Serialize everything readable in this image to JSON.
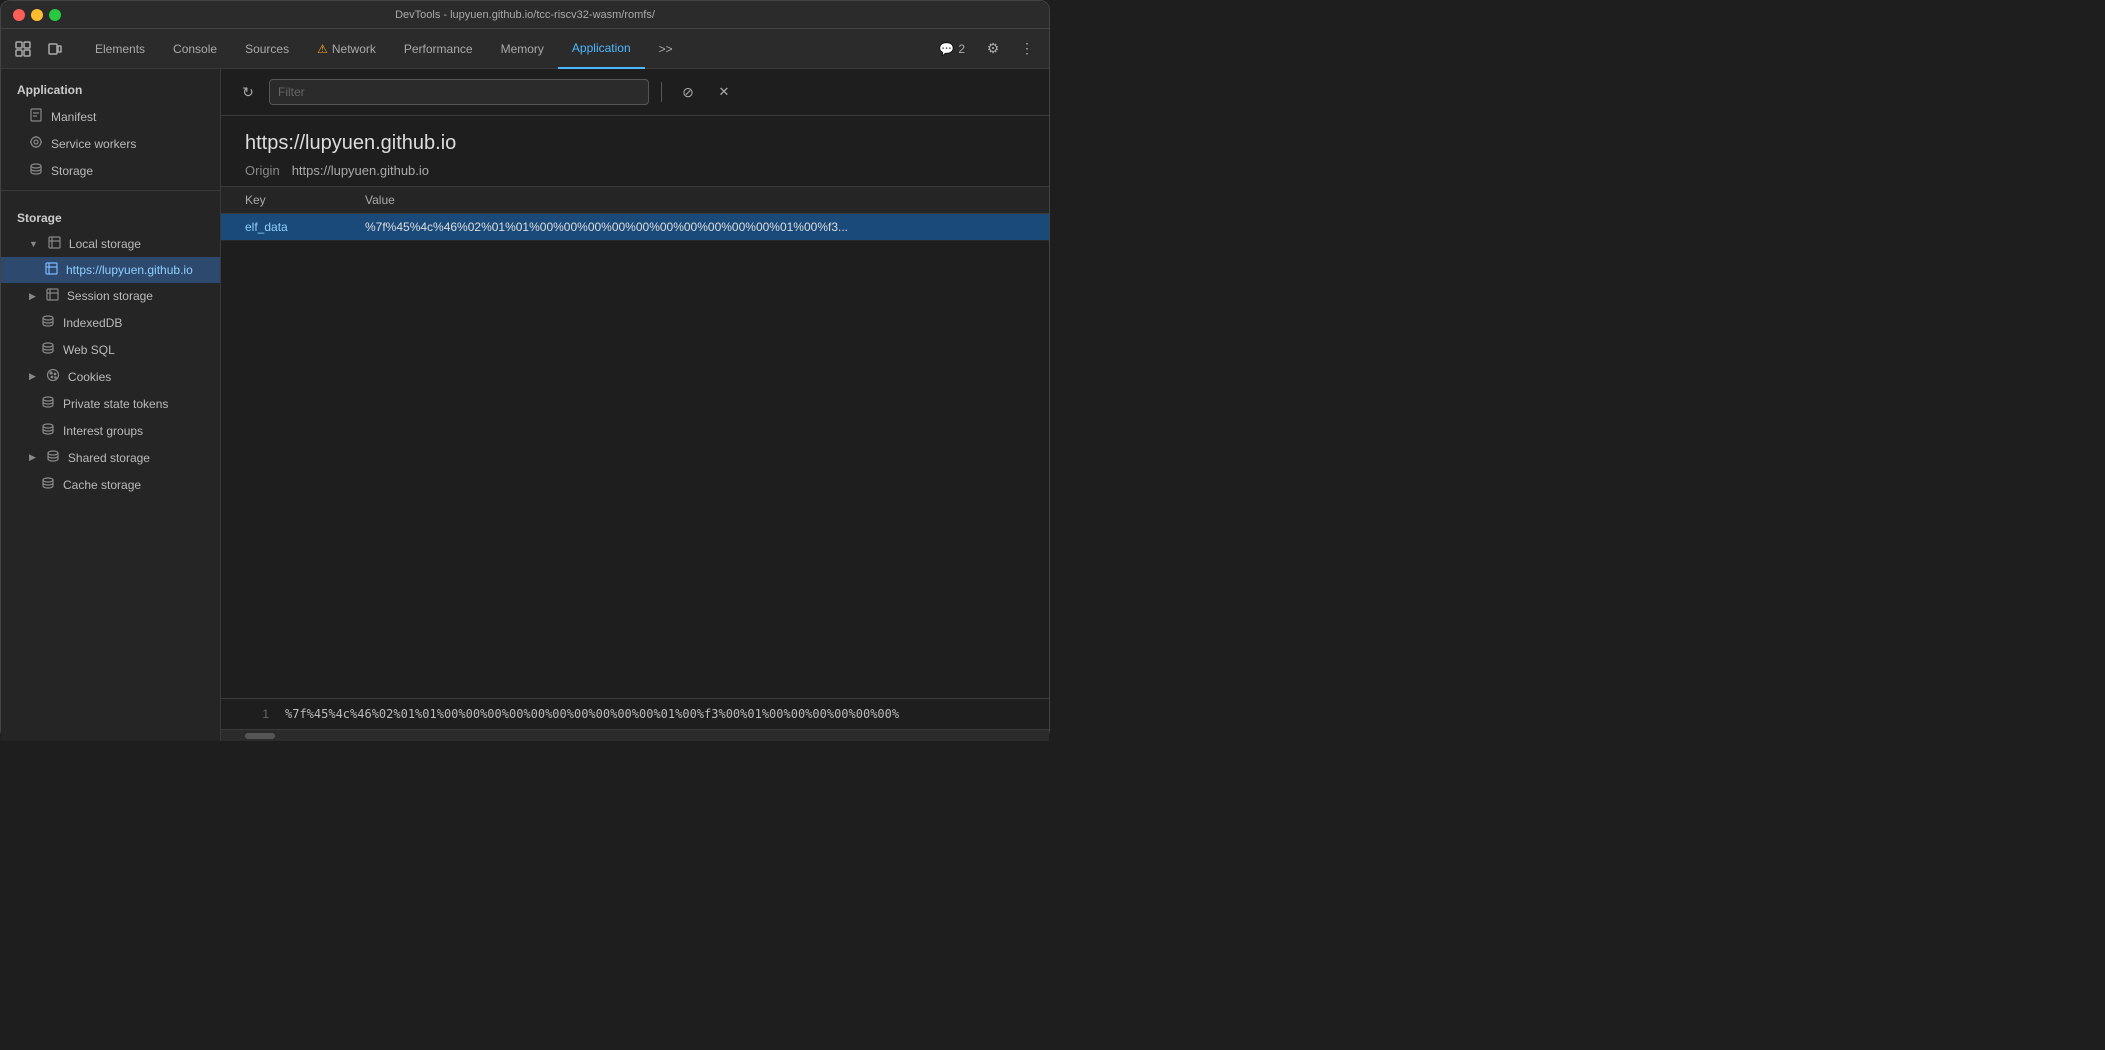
{
  "titleBar": {
    "title": "DevTools - lupyuen.github.io/tcc-riscv32-wasm/romfs/"
  },
  "tabs": {
    "items": [
      {
        "id": "elements",
        "label": "Elements",
        "active": false,
        "warning": false
      },
      {
        "id": "console",
        "label": "Console",
        "active": false,
        "warning": false
      },
      {
        "id": "sources",
        "label": "Sources",
        "active": false,
        "warning": false
      },
      {
        "id": "network",
        "label": "Network",
        "active": false,
        "warning": true
      },
      {
        "id": "performance",
        "label": "Performance",
        "active": false,
        "warning": false
      },
      {
        "id": "memory",
        "label": "Memory",
        "active": false,
        "warning": false
      },
      {
        "id": "application",
        "label": "Application",
        "active": true,
        "warning": false
      }
    ],
    "overflow_label": ">>",
    "chat_count": "2",
    "settings_icon": "⚙",
    "more_icon": "⋮"
  },
  "sidebar": {
    "application_header": "Application",
    "application_items": [
      {
        "id": "manifest",
        "label": "Manifest",
        "icon": "📄",
        "indent": 1
      },
      {
        "id": "service-workers",
        "label": "Service workers",
        "icon": "⚙",
        "indent": 1
      },
      {
        "id": "storage",
        "label": "Storage",
        "icon": "🗄",
        "indent": 1
      }
    ],
    "storage_header": "Storage",
    "storage_items": [
      {
        "id": "local-storage",
        "label": "Local storage",
        "icon": "▦",
        "indent": 1,
        "expanded": true,
        "arrow": "▼"
      },
      {
        "id": "local-storage-url",
        "label": "https://lupyuen.github.io",
        "icon": "▦",
        "indent": 2,
        "active": true
      },
      {
        "id": "session-storage",
        "label": "Session storage",
        "icon": "▦",
        "indent": 1,
        "expanded": false,
        "arrow": "▶"
      },
      {
        "id": "indexeddb",
        "label": "IndexedDB",
        "icon": "🗄",
        "indent": 1
      },
      {
        "id": "web-sql",
        "label": "Web SQL",
        "icon": "🗄",
        "indent": 1
      },
      {
        "id": "cookies",
        "label": "Cookies",
        "icon": "🍪",
        "indent": 1,
        "expanded": false,
        "arrow": "▶"
      },
      {
        "id": "private-state-tokens",
        "label": "Private state tokens",
        "icon": "🗄",
        "indent": 1
      },
      {
        "id": "interest-groups",
        "label": "Interest groups",
        "icon": "🗄",
        "indent": 1
      },
      {
        "id": "shared-storage",
        "label": "Shared storage",
        "icon": "🗄",
        "indent": 1,
        "expanded": false,
        "arrow": "▶"
      },
      {
        "id": "cache-storage",
        "label": "Cache storage",
        "icon": "🗄",
        "indent": 1
      }
    ]
  },
  "filterBar": {
    "placeholder": "Filter",
    "refresh_label": "↻",
    "clear_icon": "🚫",
    "close_icon": "✕"
  },
  "content": {
    "origin_url": "https://lupyuen.github.io",
    "origin_label": "Origin",
    "origin_value": "https://lupyuen.github.io",
    "table_headers": {
      "key": "Key",
      "value": "Value"
    },
    "rows": [
      {
        "key": "elf_data",
        "value": "%7f%45%4c%46%02%01%01%00%00%00%00%00%00%00%00%00%00%01%00%f3...",
        "selected": true
      }
    ],
    "bottom_row_number": "1",
    "bottom_value": "%7f%45%4c%46%02%01%01%00%00%00%00%00%00%00%00%00%00%01%00%f3%00%01%00%00%00%00%00%00%"
  }
}
